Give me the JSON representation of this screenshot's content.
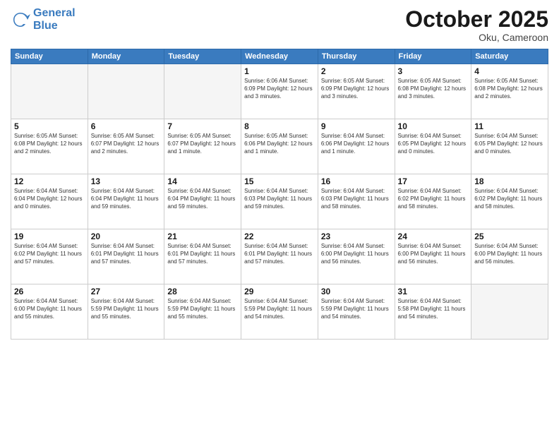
{
  "header": {
    "logo_line1": "General",
    "logo_line2": "Blue",
    "month": "October 2025",
    "location": "Oku, Cameroon"
  },
  "weekdays": [
    "Sunday",
    "Monday",
    "Tuesday",
    "Wednesday",
    "Thursday",
    "Friday",
    "Saturday"
  ],
  "weeks": [
    [
      {
        "day": "",
        "info": ""
      },
      {
        "day": "",
        "info": ""
      },
      {
        "day": "",
        "info": ""
      },
      {
        "day": "1",
        "info": "Sunrise: 6:06 AM\nSunset: 6:09 PM\nDaylight: 12 hours\nand 3 minutes."
      },
      {
        "day": "2",
        "info": "Sunrise: 6:05 AM\nSunset: 6:09 PM\nDaylight: 12 hours\nand 3 minutes."
      },
      {
        "day": "3",
        "info": "Sunrise: 6:05 AM\nSunset: 6:08 PM\nDaylight: 12 hours\nand 3 minutes."
      },
      {
        "day": "4",
        "info": "Sunrise: 6:05 AM\nSunset: 6:08 PM\nDaylight: 12 hours\nand 2 minutes."
      }
    ],
    [
      {
        "day": "5",
        "info": "Sunrise: 6:05 AM\nSunset: 6:08 PM\nDaylight: 12 hours\nand 2 minutes."
      },
      {
        "day": "6",
        "info": "Sunrise: 6:05 AM\nSunset: 6:07 PM\nDaylight: 12 hours\nand 2 minutes."
      },
      {
        "day": "7",
        "info": "Sunrise: 6:05 AM\nSunset: 6:07 PM\nDaylight: 12 hours\nand 1 minute."
      },
      {
        "day": "8",
        "info": "Sunrise: 6:05 AM\nSunset: 6:06 PM\nDaylight: 12 hours\nand 1 minute."
      },
      {
        "day": "9",
        "info": "Sunrise: 6:04 AM\nSunset: 6:06 PM\nDaylight: 12 hours\nand 1 minute."
      },
      {
        "day": "10",
        "info": "Sunrise: 6:04 AM\nSunset: 6:05 PM\nDaylight: 12 hours\nand 0 minutes."
      },
      {
        "day": "11",
        "info": "Sunrise: 6:04 AM\nSunset: 6:05 PM\nDaylight: 12 hours\nand 0 minutes."
      }
    ],
    [
      {
        "day": "12",
        "info": "Sunrise: 6:04 AM\nSunset: 6:04 PM\nDaylight: 12 hours\nand 0 minutes."
      },
      {
        "day": "13",
        "info": "Sunrise: 6:04 AM\nSunset: 6:04 PM\nDaylight: 11 hours\nand 59 minutes."
      },
      {
        "day": "14",
        "info": "Sunrise: 6:04 AM\nSunset: 6:04 PM\nDaylight: 11 hours\nand 59 minutes."
      },
      {
        "day": "15",
        "info": "Sunrise: 6:04 AM\nSunset: 6:03 PM\nDaylight: 11 hours\nand 59 minutes."
      },
      {
        "day": "16",
        "info": "Sunrise: 6:04 AM\nSunset: 6:03 PM\nDaylight: 11 hours\nand 58 minutes."
      },
      {
        "day": "17",
        "info": "Sunrise: 6:04 AM\nSunset: 6:02 PM\nDaylight: 11 hours\nand 58 minutes."
      },
      {
        "day": "18",
        "info": "Sunrise: 6:04 AM\nSunset: 6:02 PM\nDaylight: 11 hours\nand 58 minutes."
      }
    ],
    [
      {
        "day": "19",
        "info": "Sunrise: 6:04 AM\nSunset: 6:02 PM\nDaylight: 11 hours\nand 57 minutes."
      },
      {
        "day": "20",
        "info": "Sunrise: 6:04 AM\nSunset: 6:01 PM\nDaylight: 11 hours\nand 57 minutes."
      },
      {
        "day": "21",
        "info": "Sunrise: 6:04 AM\nSunset: 6:01 PM\nDaylight: 11 hours\nand 57 minutes."
      },
      {
        "day": "22",
        "info": "Sunrise: 6:04 AM\nSunset: 6:01 PM\nDaylight: 11 hours\nand 57 minutes."
      },
      {
        "day": "23",
        "info": "Sunrise: 6:04 AM\nSunset: 6:00 PM\nDaylight: 11 hours\nand 56 minutes."
      },
      {
        "day": "24",
        "info": "Sunrise: 6:04 AM\nSunset: 6:00 PM\nDaylight: 11 hours\nand 56 minutes."
      },
      {
        "day": "25",
        "info": "Sunrise: 6:04 AM\nSunset: 6:00 PM\nDaylight: 11 hours\nand 56 minutes."
      }
    ],
    [
      {
        "day": "26",
        "info": "Sunrise: 6:04 AM\nSunset: 6:00 PM\nDaylight: 11 hours\nand 55 minutes."
      },
      {
        "day": "27",
        "info": "Sunrise: 6:04 AM\nSunset: 5:59 PM\nDaylight: 11 hours\nand 55 minutes."
      },
      {
        "day": "28",
        "info": "Sunrise: 6:04 AM\nSunset: 5:59 PM\nDaylight: 11 hours\nand 55 minutes."
      },
      {
        "day": "29",
        "info": "Sunrise: 6:04 AM\nSunset: 5:59 PM\nDaylight: 11 hours\nand 54 minutes."
      },
      {
        "day": "30",
        "info": "Sunrise: 6:04 AM\nSunset: 5:59 PM\nDaylight: 11 hours\nand 54 minutes."
      },
      {
        "day": "31",
        "info": "Sunrise: 6:04 AM\nSunset: 5:58 PM\nDaylight: 11 hours\nand 54 minutes."
      },
      {
        "day": "",
        "info": ""
      }
    ]
  ]
}
